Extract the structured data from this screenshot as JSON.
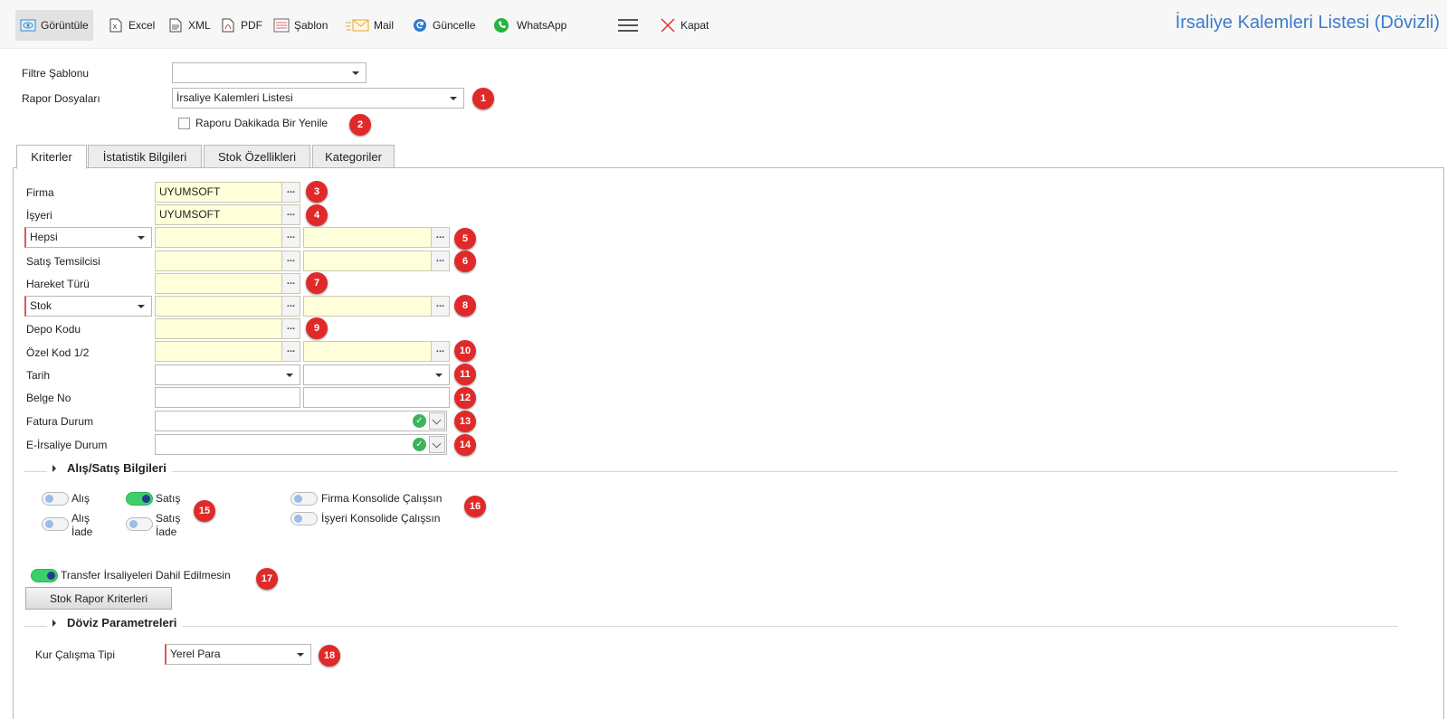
{
  "toolbar": {
    "view": "Görüntüle",
    "excel": "Excel",
    "xml": "XML",
    "pdf": "PDF",
    "template": "Şablon",
    "mail": "Mail",
    "update": "Güncelle",
    "whatsapp": "WhatsApp",
    "close": "Kapat"
  },
  "title": "İrsaliye Kalemleri Listesi (Dövizli)",
  "header": {
    "filter_template_label": "Filtre Şablonu",
    "filter_template_value": "",
    "report_files_label": "Rapor Dosyaları",
    "report_files_value": "İrsaliye Kalemleri Listesi",
    "refresh_label": "Raporu Dakikada Bir Yenile"
  },
  "tabs": [
    "Kriterler",
    "İstatistik Bilgileri",
    "Stok Özellikleri",
    "Kategoriler"
  ],
  "form": {
    "firma_label": "Firma",
    "firma_value": "UYUMSOFT",
    "isyeri_label": "İşyeri",
    "isyeri_value": "UYUMSOFT",
    "cari_select": "Hepsi",
    "satis_temsilcisi_label": "Satış Temsilcisi",
    "hareket_turu_label": "Hareket Türü",
    "stok_select": "Stok",
    "depo_kodu_label": "Depo Kodu",
    "ozel_kod_label": "Özel Kod 1/2",
    "tarih_label": "Tarih",
    "belge_no_label": "Belge No",
    "fatura_durum_label": "Fatura Durum",
    "e_irsaliye_durum_label": "E-İrsaliye Durum"
  },
  "alis_satis": {
    "title": "Alış/Satış Bilgileri",
    "alis": "Alış",
    "satis": "Satış",
    "alis_iade_1": "Alış",
    "alis_iade_2": "İade",
    "satis_iade_1": "Satış",
    "satis_iade_2": "İade",
    "firma_konsolide": "Firma Konsolide Çalışsın",
    "isyeri_konsolide": "İşyeri Konsolide Çalışsın",
    "transfer": "Transfer İrsaliyeleri Dahil Edilmesin",
    "stok_rapor_button": "Stok Rapor Kriterleri"
  },
  "doviz": {
    "title": "Döviz Parametreleri",
    "kur_label": "Kur Çalışma Tipi",
    "kur_value": "Yerel Para"
  },
  "badges": [
    "1",
    "2",
    "3",
    "4",
    "5",
    "6",
    "7",
    "8",
    "9",
    "10",
    "11",
    "12",
    "13",
    "14",
    "15",
    "16",
    "17",
    "18"
  ],
  "colors": {
    "accent": "#3d7cc9",
    "badge": "#e02a2a",
    "lookup_bg": "#ffffd9",
    "toggle_on": "#3ccf6a"
  }
}
